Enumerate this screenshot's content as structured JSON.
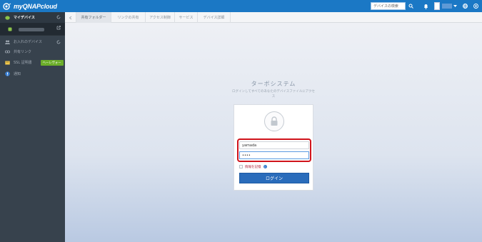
{
  "header": {
    "brand": "myQNAPcloud",
    "search_placeholder": "デバイスの検索"
  },
  "sidebar": {
    "my_devices": "マイデバイス",
    "device_name": "",
    "favorites": "お入れのデバイス",
    "shared_links": "共有リンク",
    "ssl": "SSL 証明書",
    "ssl_badge": "ヘーレヴォー",
    "notice": "通知"
  },
  "tabs": [
    {
      "label": "共有フォルダー"
    },
    {
      "label": "リンクの共有"
    },
    {
      "label": "アクセス制御"
    },
    {
      "label": "サービス"
    },
    {
      "label": "デバイス詳細"
    }
  ],
  "login": {
    "title": "ターボシステム",
    "subtitle": "ログインしてすべてのあなたのデバイスファイルにアクセス",
    "username_value": "yamada",
    "password_value": "••••",
    "remember_label": "情報を記憶",
    "info_glyph": "i",
    "login_button": "ログイン"
  },
  "colors": {
    "brand_blue": "#1b78c5",
    "sidebar_bg": "#37424d",
    "login_button": "#2a6cbb",
    "highlight_red": "#d0131b",
    "ssl_badge_green": "#6cae2a"
  },
  "icons": [
    "cloud-logo-icon",
    "search-icon",
    "bell-icon",
    "globe-icon",
    "power-icon",
    "refresh-icon",
    "external-link-icon",
    "lock-icon",
    "info-icon"
  ]
}
